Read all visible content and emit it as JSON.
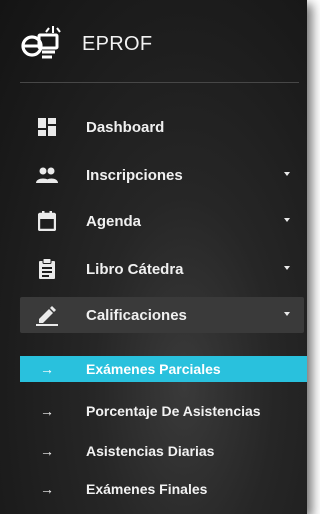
{
  "brand": {
    "name": "EPROF",
    "logo_icon": "eprof-logo-icon"
  },
  "menu": [
    {
      "label": "Dashboard",
      "icon": "dashboard-icon",
      "has_submenu": false
    },
    {
      "label": "Inscripciones",
      "icon": "people-icon",
      "has_submenu": true
    },
    {
      "label": "Agenda",
      "icon": "calendar-icon",
      "has_submenu": true
    },
    {
      "label": "Libro Cátedra",
      "icon": "clipboard-icon",
      "has_submenu": true
    },
    {
      "label": "Calificaciones",
      "icon": "pencil-icon",
      "has_submenu": true,
      "active": true
    }
  ],
  "submenu": [
    {
      "label": "Exámenes Parciales",
      "selected": true
    },
    {
      "label": "Porcentaje De Asistencias"
    },
    {
      "label": "Asistencias Diarias"
    },
    {
      "label": "Exámenes Finales"
    }
  ],
  "colors": {
    "sidebar_bg": "#1c1c1c",
    "selected_bg": "#29c1dd",
    "active_bg": "#3a3a3a",
    "text": "#f0f0f0"
  }
}
